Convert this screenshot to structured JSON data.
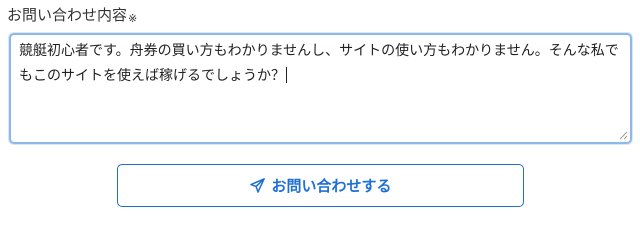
{
  "form": {
    "label": "お問い合わせ内容",
    "required_mark": "※",
    "textarea_value": "競艇初心者です。舟券の買い方もわかりませんし、サイトの使い方もわかりません。そんな私でもこのサイトを使えば稼げるでしょうか？",
    "submit_label": "お問い合わせする",
    "submit_icon": "paper-plane-icon"
  },
  "colors": {
    "accent": "#1f6fd6",
    "focus_border": "#8fb8ea",
    "text": "#333333"
  }
}
